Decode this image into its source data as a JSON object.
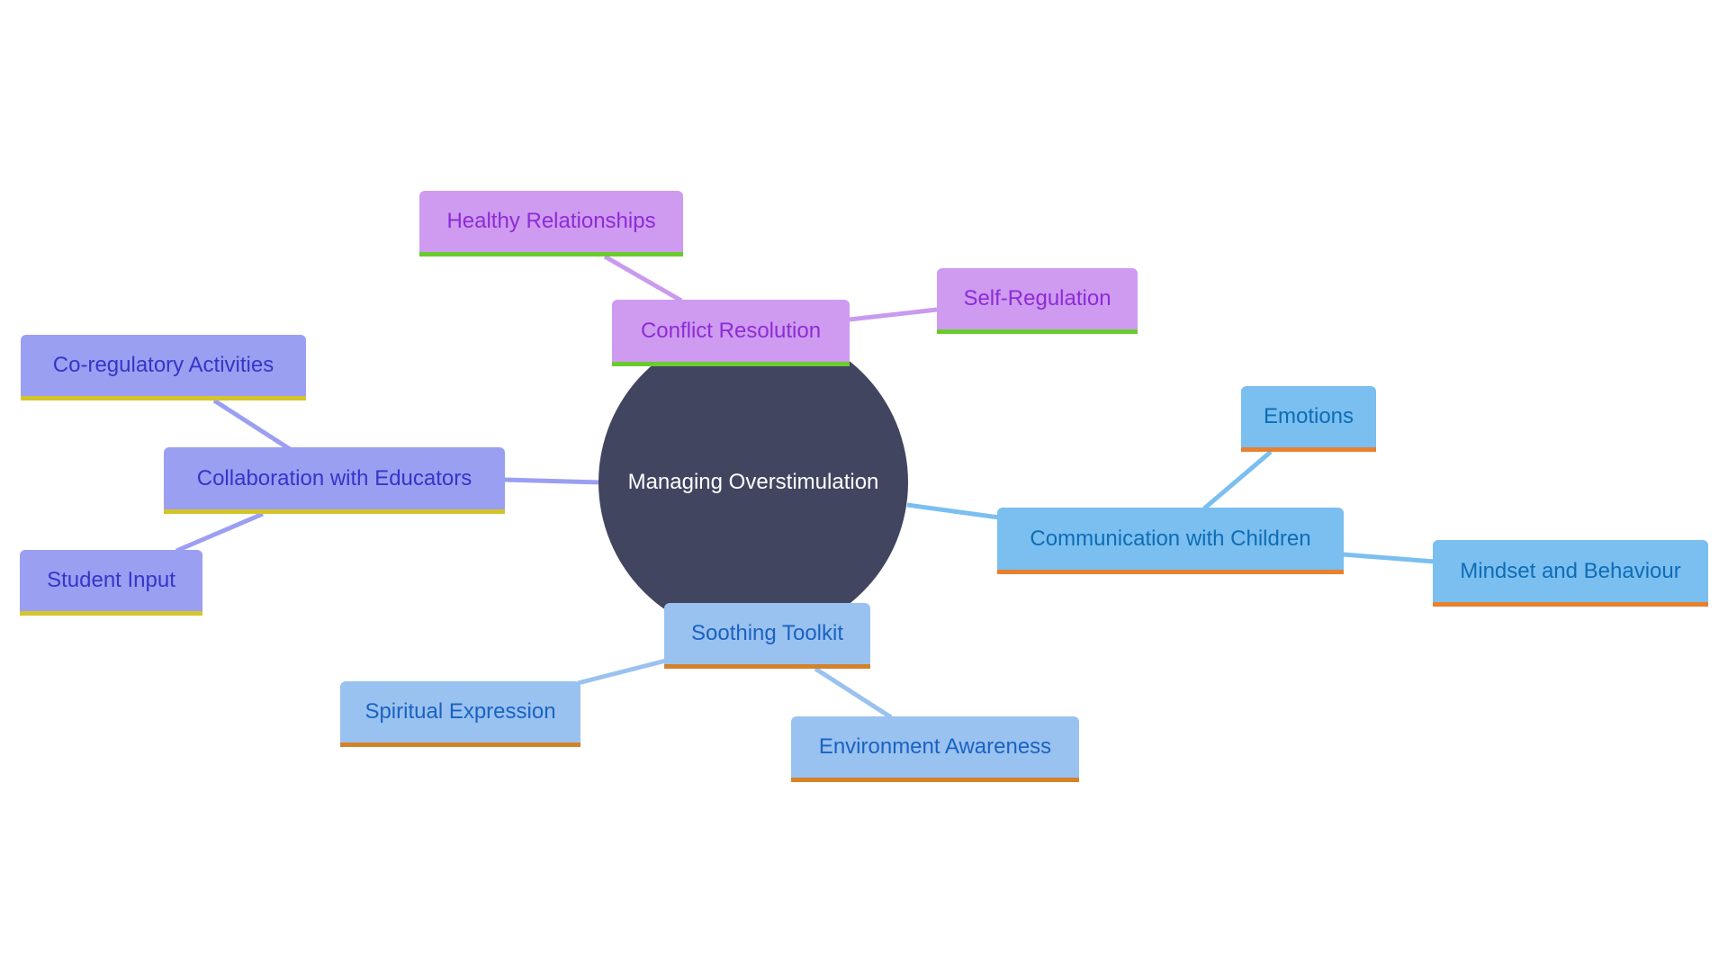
{
  "root": {
    "label": "Managing Overstimulation"
  },
  "colors": {
    "center_fill": "#414560",
    "purple": {
      "fill": "#CE9BF0",
      "text": "#8E2BD6",
      "accent": "#6BCB2E",
      "edge": "#C99AEE"
    },
    "indigo": {
      "fill": "#9B9FF2",
      "text": "#3535C8",
      "accent": "#D4C52A",
      "edge": "#9B9FF2"
    },
    "sky": {
      "fill": "#7ABFF0",
      "text": "#0F6CB5",
      "accent": "#E8812F",
      "edge": "#7ABFF0"
    },
    "soft": {
      "fill": "#9AC2F0",
      "text": "#1A62C2",
      "accent": "#D4822A",
      "edge": "#9AC2F0"
    }
  },
  "branches": [
    {
      "label": "Conflict Resolution",
      "group": "purple",
      "children": [
        {
          "label": "Healthy Relationships"
        },
        {
          "label": "Self-Regulation"
        }
      ]
    },
    {
      "label": "Collaboration with Educators",
      "group": "indigo",
      "children": [
        {
          "label": "Co-regulatory Activities"
        },
        {
          "label": "Student Input"
        }
      ]
    },
    {
      "label": "Communication with Children",
      "group": "sky",
      "children": [
        {
          "label": "Emotions"
        },
        {
          "label": "Mindset and Behaviour"
        }
      ]
    },
    {
      "label": "Soothing Toolkit",
      "group": "soft",
      "children": [
        {
          "label": "Spiritual Expression"
        },
        {
          "label": "Environment Awareness"
        }
      ]
    }
  ]
}
